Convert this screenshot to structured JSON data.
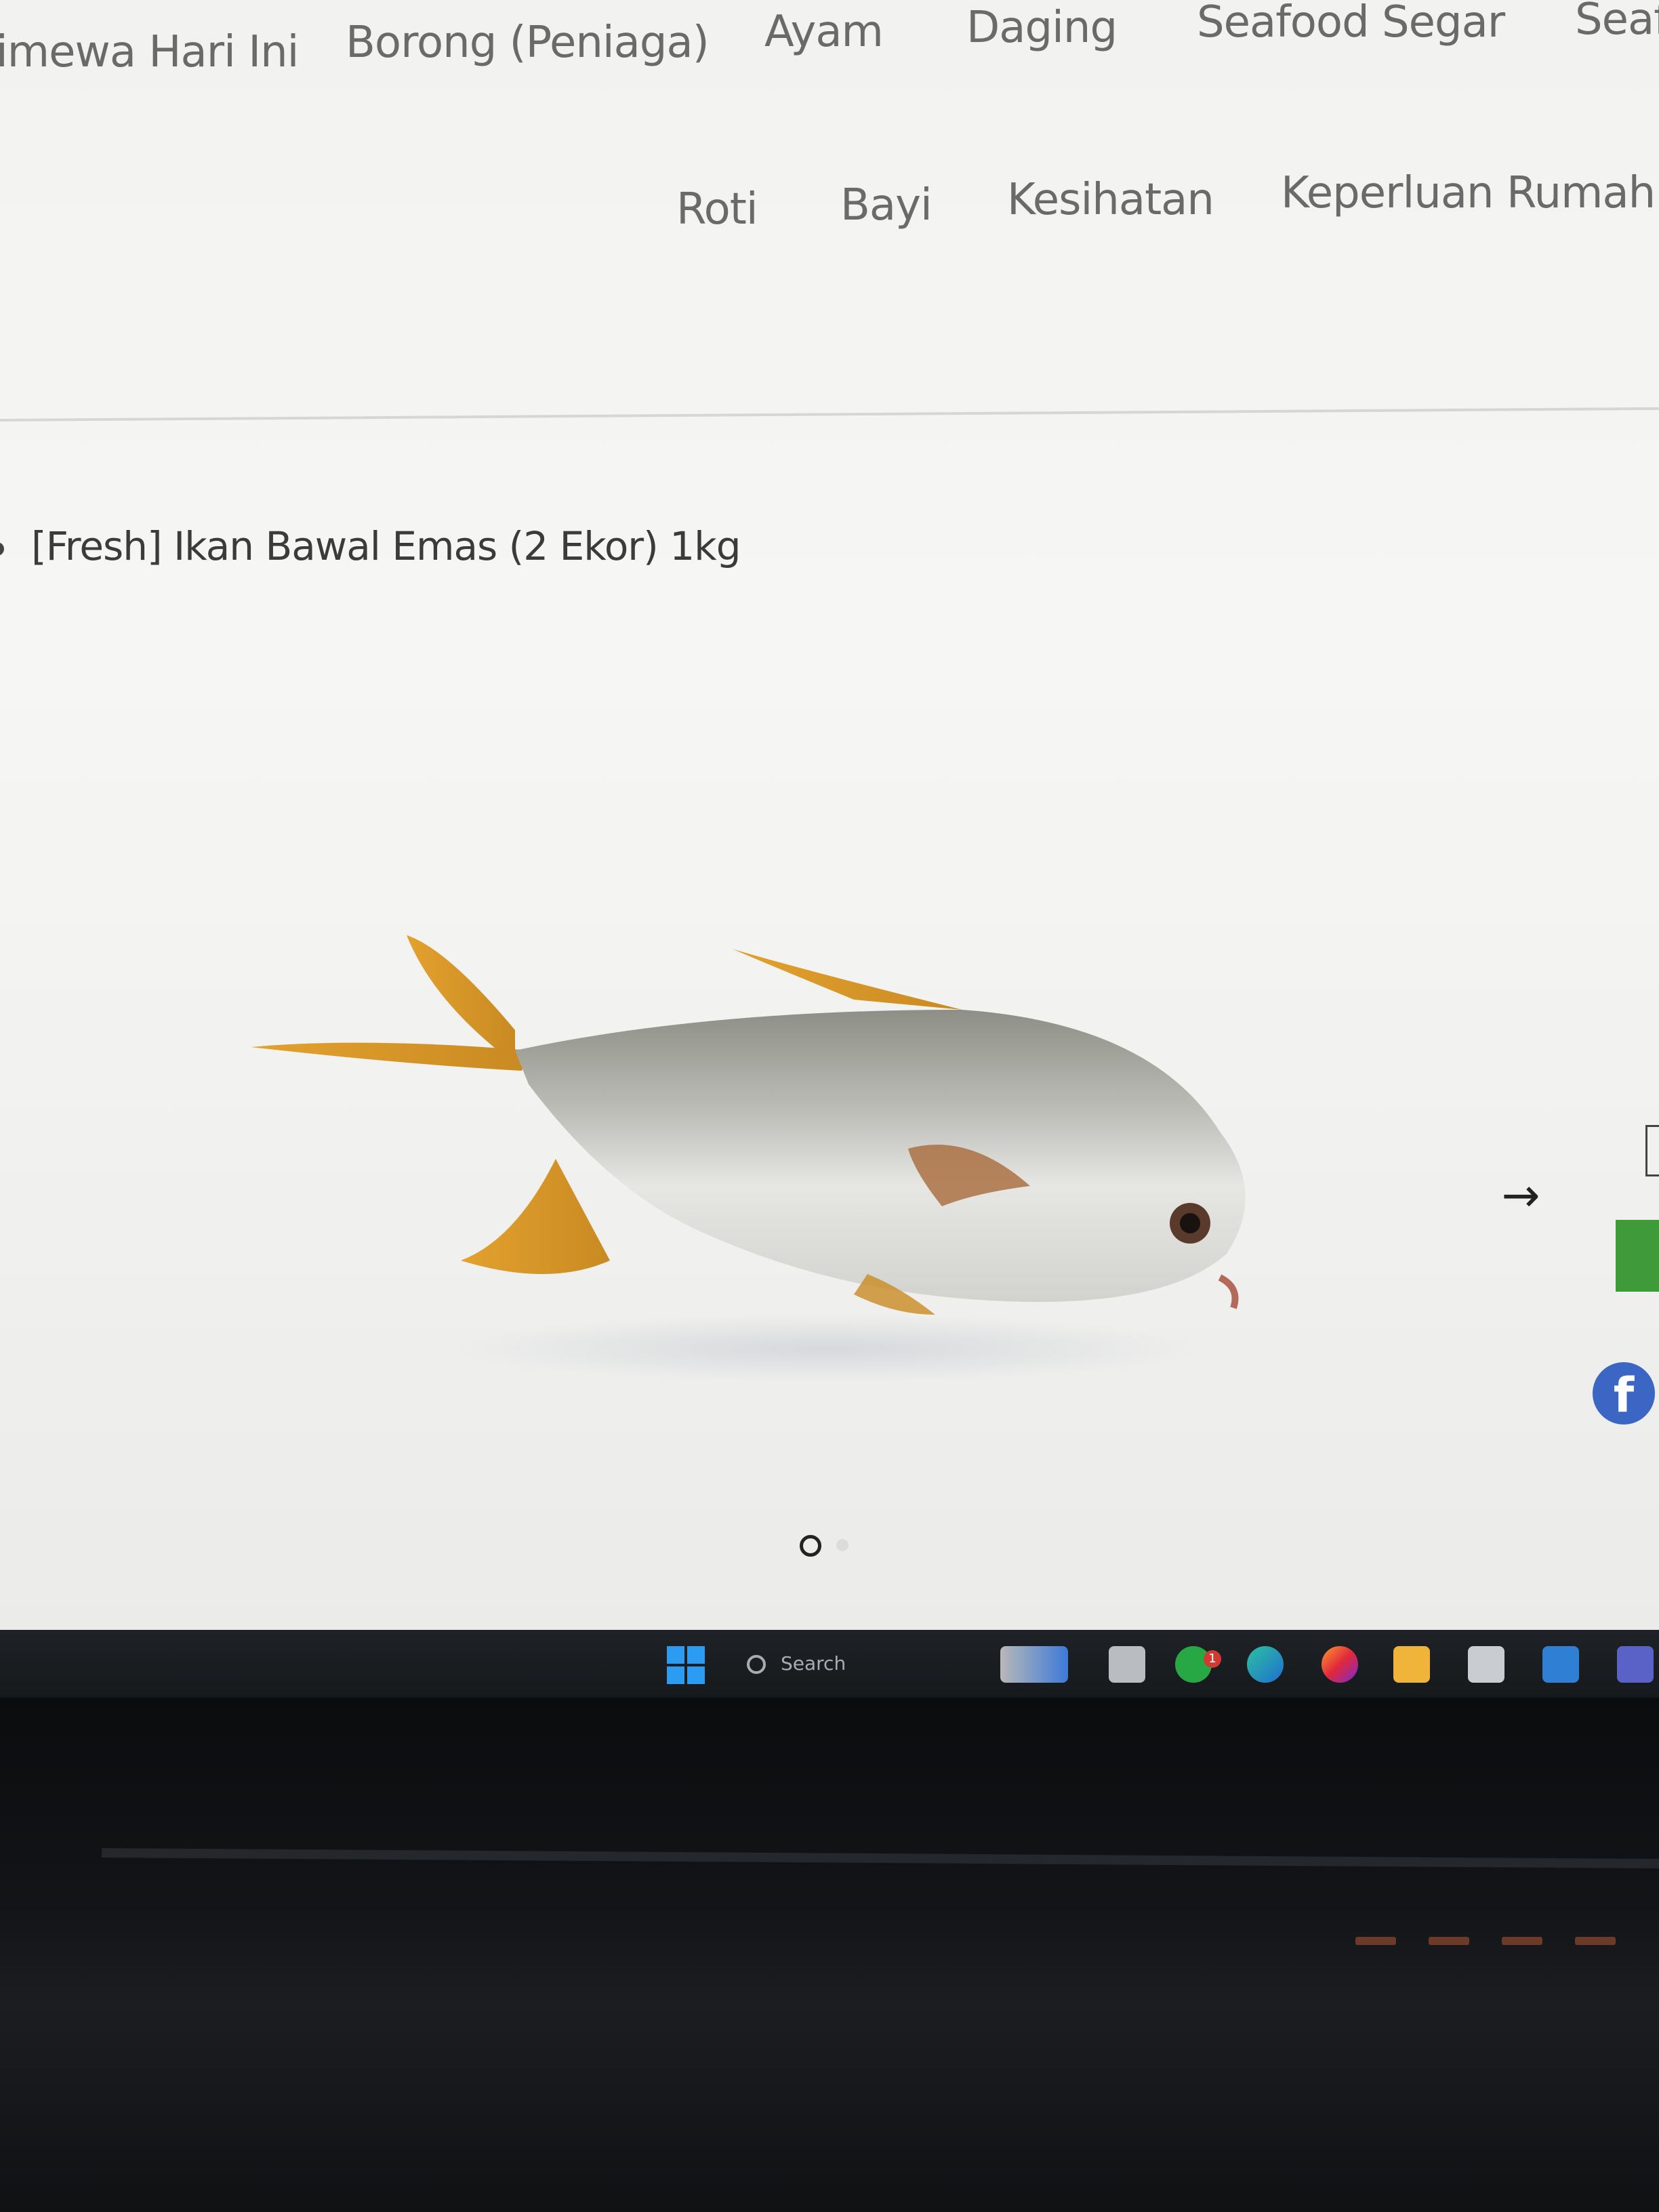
{
  "nav": {
    "row1": [
      "imewa Hari Ini",
      "Borong (Peniaga)",
      "Ayam",
      "Daging",
      "Seafood Segar",
      "Seaf"
    ],
    "row2": [
      "Roti",
      "Bayi",
      "Kesihatan",
      "Keperluan Rumah"
    ]
  },
  "product": {
    "title": "[Fresh] Ikan Bawal Emas (2 Ekor) 1kg"
  },
  "icons": {
    "next": "arrow-right-icon",
    "facebook": "facebook-icon",
    "windows": "windows-start-icon",
    "search": "search-icon"
  },
  "taskbar": {
    "search_placeholder": "Search",
    "whatsapp_badge": "1"
  },
  "colors": {
    "nav_text": "#6a6a6a",
    "accent_green": "#3f9a3a",
    "facebook_blue": "#3b66c4",
    "taskbar_bg": "#1e2226",
    "windows_blue": "#2c9cf2"
  }
}
